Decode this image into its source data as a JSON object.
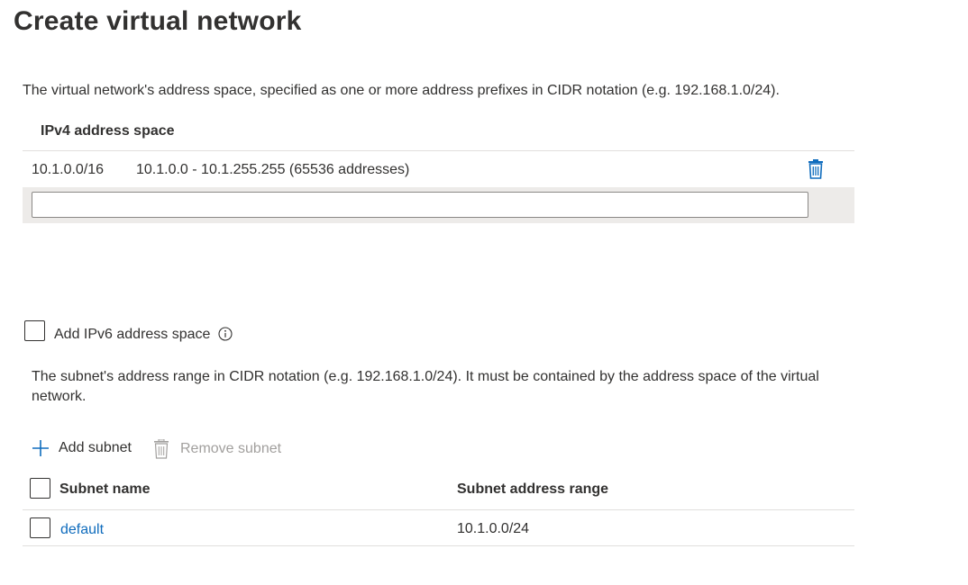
{
  "page": {
    "title": "Create virtual network"
  },
  "ipv4": {
    "description": "The virtual network's address space, specified as one or more address prefixes in CIDR notation (e.g. 192.168.1.0/24).",
    "header": "IPv4 address space",
    "entries": [
      {
        "prefix": "10.1.0.0/16",
        "range": "10.1.0.0 - 10.1.255.255 (65536 addresses)"
      }
    ],
    "new_input_value": "",
    "delete_icon": "trash-icon"
  },
  "ipv6": {
    "checkbox_label": "Add IPv6 address space",
    "checked": false,
    "info_icon": "info-icon"
  },
  "subnets": {
    "description": "The subnet's address range in CIDR notation (e.g. 192.168.1.0/24). It must be contained by the address space of the virtual network.",
    "toolbar": {
      "add_label": "Add subnet",
      "remove_label": "Remove subnet"
    },
    "columns": [
      "Subnet name",
      "Subnet address range"
    ],
    "rows": [
      {
        "name": "default",
        "range": "10.1.0.0/24"
      }
    ]
  },
  "colors": {
    "accent": "#0f6cbd",
    "disabled_text": "#a19f9d",
    "row_highlight": "#edebe9"
  }
}
